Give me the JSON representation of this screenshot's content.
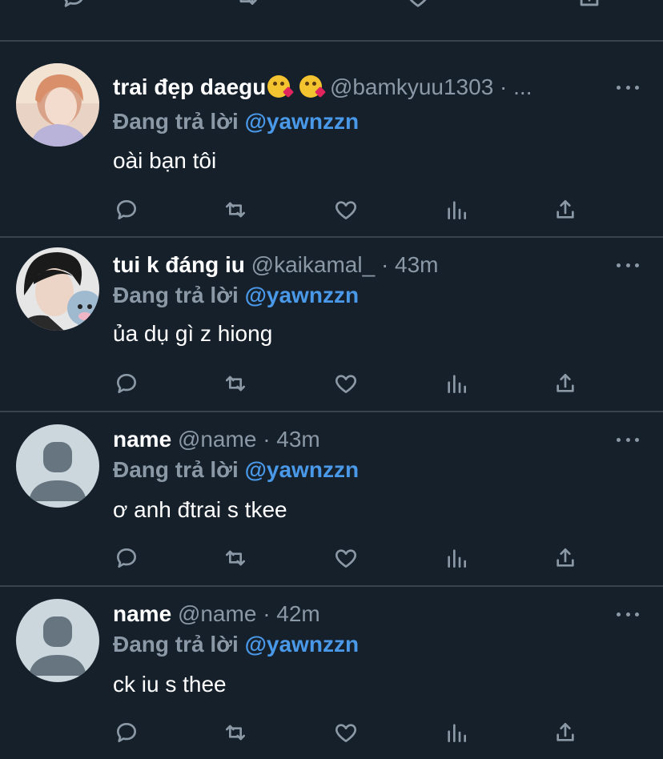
{
  "reply_prefix": "Đang trả lời",
  "tweets": [
    {
      "display_name": "trai đẹp daegu",
      "handle": "@bamkyuu1303",
      "time": "· ...",
      "reply_to": "@yawnzzn",
      "text": "oài bạn tôi",
      "emoji": [
        "face-blowing-kiss",
        "face-blowing-kiss"
      ],
      "avatar": "photo-pink-hair"
    },
    {
      "display_name": "tui k đáng iu",
      "handle": "@kaikamal_",
      "time": "· 43m",
      "reply_to": "@yawnzzn",
      "text": "ủa dụ gì z hiong",
      "avatar": "photo-with-plush"
    },
    {
      "display_name": "name",
      "handle": "@name",
      "time": "· 43m",
      "reply_to": "@yawnzzn",
      "text": "ơ anh đtrai s tkee",
      "avatar": "default-avatar"
    },
    {
      "display_name": "name",
      "handle": "@name",
      "time": "· 42m",
      "reply_to": "@yawnzzn",
      "text": "ck iu s thee",
      "avatar": "default-avatar"
    }
  ],
  "actions": [
    "reply-icon",
    "retweet-icon",
    "like-icon",
    "analytics-icon",
    "share-icon"
  ],
  "colors": {
    "background": "#15202b",
    "divider": "#38444d",
    "muted": "#8b98a5",
    "mention": "#4a99e9",
    "text": "#ffffff"
  }
}
